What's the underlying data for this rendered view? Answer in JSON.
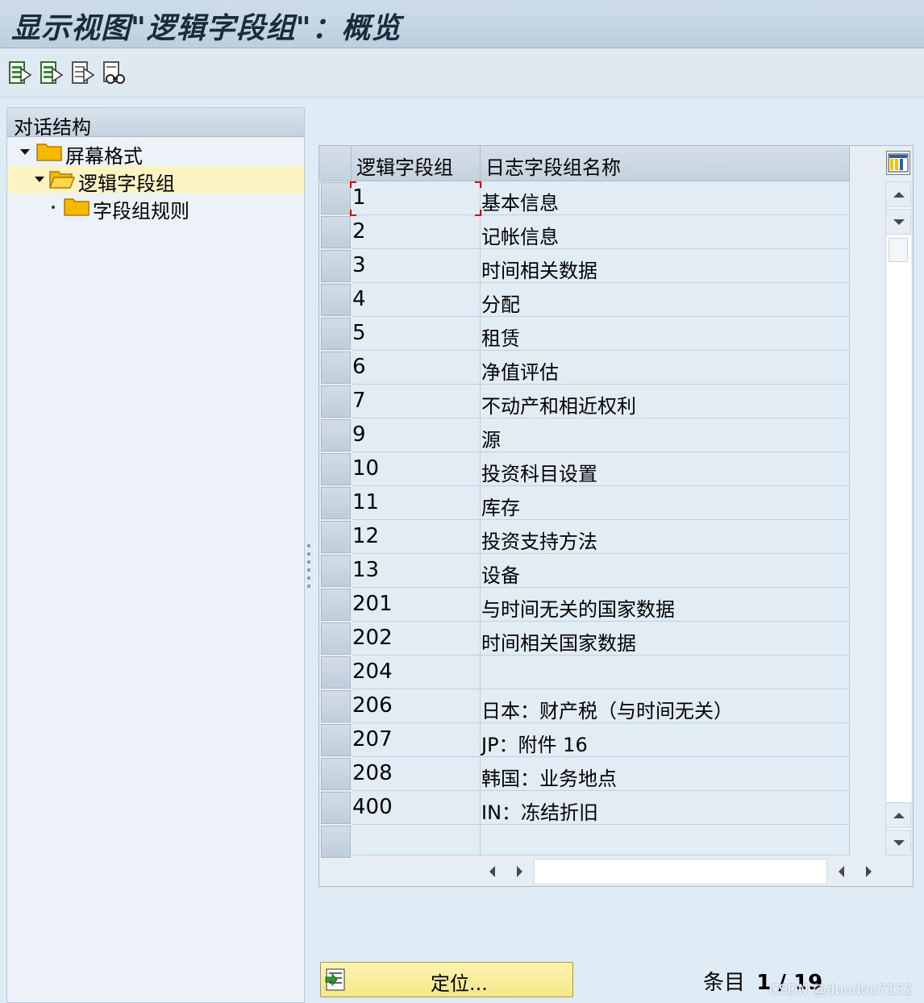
{
  "window": {
    "title": "显示视图\"逻辑字段组\"：概览"
  },
  "toolbar": {
    "buttons": [
      {
        "icon": "choose-icon"
      },
      {
        "icon": "save-as-variant-icon"
      },
      {
        "icon": "details-icon"
      },
      {
        "icon": "find-icon"
      }
    ]
  },
  "dialog_structure": {
    "heading": "对话结构",
    "items": [
      {
        "label": "屏幕格式",
        "expanded": true,
        "selected": false
      },
      {
        "label": "逻辑字段组",
        "expanded": true,
        "selected": true
      },
      {
        "label": "字段组规则",
        "expanded": false,
        "selected": false
      }
    ]
  },
  "table": {
    "columns": [
      "逻辑字段组",
      "日志字段组名称"
    ],
    "rows": [
      [
        "1",
        "基本信息"
      ],
      [
        "2",
        "记帐信息"
      ],
      [
        "3",
        "时间相关数据"
      ],
      [
        "4",
        "分配"
      ],
      [
        "5",
        "租赁"
      ],
      [
        "6",
        "净值评估"
      ],
      [
        "7",
        "不动产和相近权利"
      ],
      [
        "9",
        "源"
      ],
      [
        "10",
        "投资科目设置"
      ],
      [
        "11",
        "库存"
      ],
      [
        "12",
        "投资支持方法"
      ],
      [
        "13",
        "设备"
      ],
      [
        "201",
        "与时间无关的国家数据"
      ],
      [
        "202",
        "时间相关国家数据"
      ],
      [
        "204",
        ""
      ],
      [
        "206",
        "日本：财产税（与时间无关）"
      ],
      [
        "207",
        "JP：附件 16"
      ],
      [
        "208",
        "韩国：业务地点"
      ],
      [
        "400",
        "IN：冻结折旧"
      ]
    ]
  },
  "footer": {
    "position_button": "定位...",
    "entries_label": "条目",
    "entries_value": "1 / 19"
  },
  "watermark": "CSDN @doudou7152",
  "colors": {
    "selected_row": "#fbf4c2",
    "button": "#f5e68a",
    "folder": "#f5b800"
  }
}
